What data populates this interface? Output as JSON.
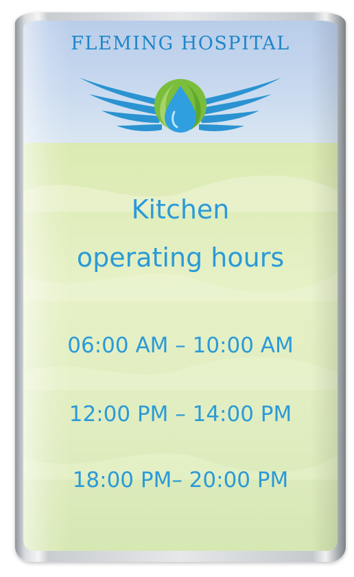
{
  "sign": {
    "hospital_name": "FLEMING HOSPITAL",
    "title_line_1": "Kitchen",
    "title_line_2": "operating hours",
    "hours": [
      "06:00 AM – 10:00 AM",
      "12:00 PM – 14:00 PM",
      "18:00 PM– 20:00 PM"
    ]
  },
  "colors": {
    "text_blue": "#2a9ad8",
    "header_blue": "#b9cdea",
    "body_green": "#e0edc0",
    "logo_green": "#7bbd3c",
    "logo_blue": "#1e86c8"
  },
  "icons": {
    "logo": "winged-drop-logo-icon"
  }
}
